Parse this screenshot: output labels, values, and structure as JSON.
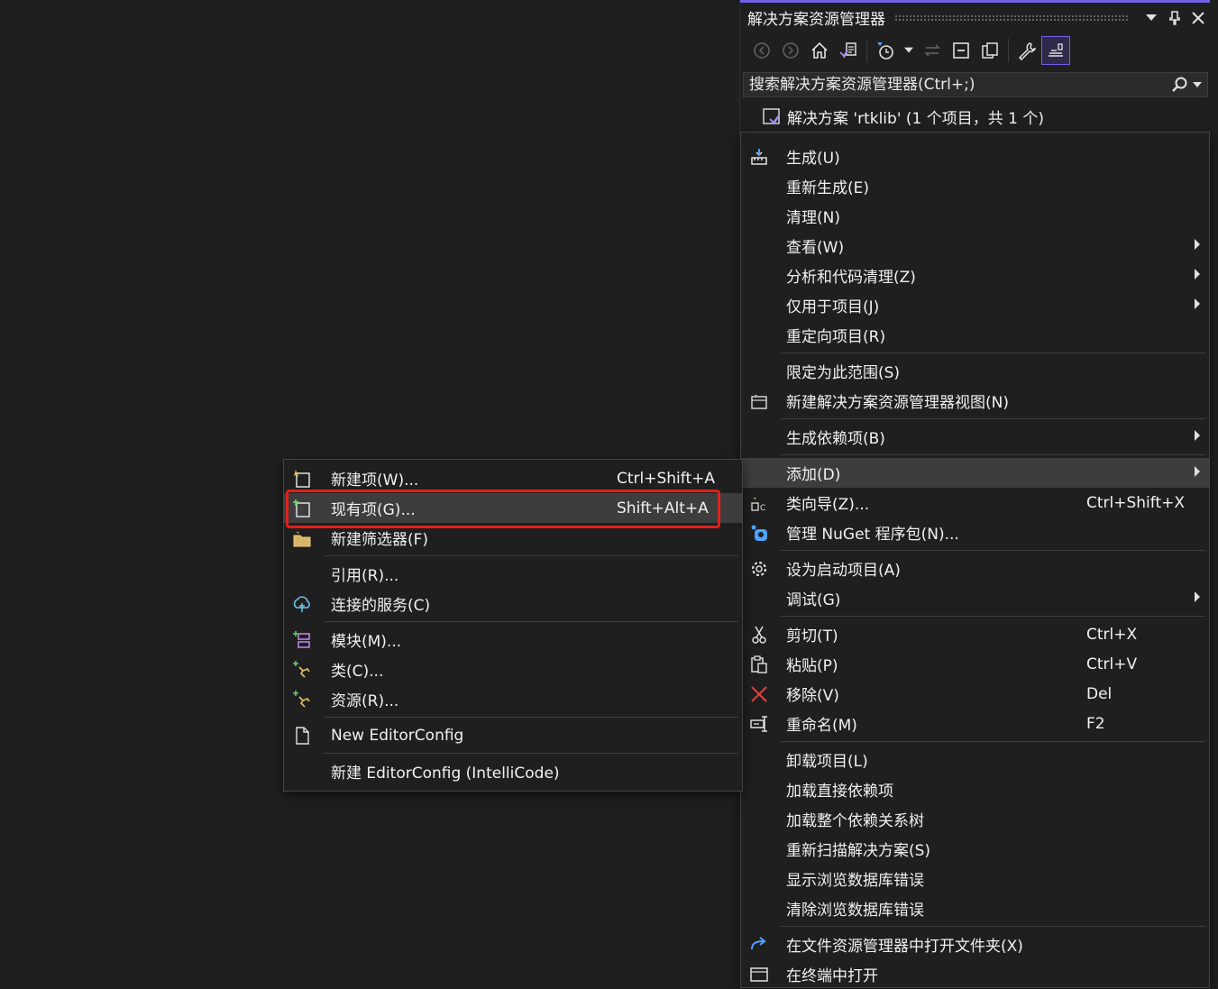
{
  "solution_explorer": {
    "title": "解决方案资源管理器",
    "search_placeholder": "搜索解决方案资源管理器(Ctrl+;)",
    "root_label": "解决方案 'rtklib' (1 个项目，共 1 个)",
    "accent_color": "#7160e8"
  },
  "context_menu": {
    "items": [
      {
        "label": "生成(U)",
        "icon": "build-icon"
      },
      {
        "label": "重新生成(E)"
      },
      {
        "label": "清理(N)"
      },
      {
        "label": "查看(W)",
        "submenu": true
      },
      {
        "label": "分析和代码清理(Z)",
        "submenu": true
      },
      {
        "label": "仅用于项目(J)",
        "submenu": true
      },
      {
        "label": "重定向项目(R)"
      },
      {
        "label": "限定为此范围(S)"
      },
      {
        "label": "新建解决方案资源管理器视图(N)",
        "icon": "new-view-icon"
      },
      {
        "label": "生成依赖项(B)",
        "submenu": true
      },
      {
        "label": "添加(D)",
        "submenu": true,
        "highlighted": true
      },
      {
        "label": "类向导(Z)...",
        "shortcut": "Ctrl+Shift+X",
        "icon": "class-wizard-icon"
      },
      {
        "label": "管理 NuGet 程序包(N)...",
        "icon": "nuget-icon"
      },
      {
        "label": "设为启动项目(A)",
        "icon": "gear-icon"
      },
      {
        "label": "调试(G)",
        "submenu": true
      },
      {
        "label": "剪切(T)",
        "shortcut": "Ctrl+X",
        "icon": "scissors-icon"
      },
      {
        "label": "粘贴(P)",
        "shortcut": "Ctrl+V",
        "icon": "paste-icon"
      },
      {
        "label": "移除(V)",
        "shortcut": "Del",
        "icon": "remove-icon"
      },
      {
        "label": "重命名(M)",
        "shortcut": "F2",
        "icon": "rename-icon"
      },
      {
        "label": "卸载项目(L)"
      },
      {
        "label": "加载直接依赖项"
      },
      {
        "label": "加载整个依赖关系树"
      },
      {
        "label": "重新扫描解决方案(S)"
      },
      {
        "label": "显示浏览数据库错误"
      },
      {
        "label": "清除浏览数据库错误"
      },
      {
        "label": "在文件资源管理器中打开文件夹(X)",
        "icon": "open-folder-icon"
      },
      {
        "label": "在终端中打开",
        "icon": "terminal-icon"
      }
    ]
  },
  "add_submenu": {
    "items": [
      {
        "label": "新建项(W)...",
        "shortcut": "Ctrl+Shift+A",
        "icon": "new-item-icon"
      },
      {
        "label": "现有项(G)...",
        "shortcut": "Shift+Alt+A",
        "icon": "existing-item-icon",
        "highlighted": true
      },
      {
        "label": "新建筛选器(F)",
        "icon": "new-filter-icon"
      },
      {
        "label": "引用(R)..."
      },
      {
        "label": "连接的服务(C)",
        "icon": "connected-service-icon"
      },
      {
        "label": "模块(M)...",
        "icon": "module-icon"
      },
      {
        "label": "类(C)...",
        "icon": "class-icon"
      },
      {
        "label": "资源(R)...",
        "icon": "resource-icon"
      },
      {
        "label": "New EditorConfig",
        "icon": "file-icon"
      },
      {
        "label": "新建 EditorConfig (IntelliCode)"
      }
    ]
  },
  "callout_color": "#e0201c"
}
